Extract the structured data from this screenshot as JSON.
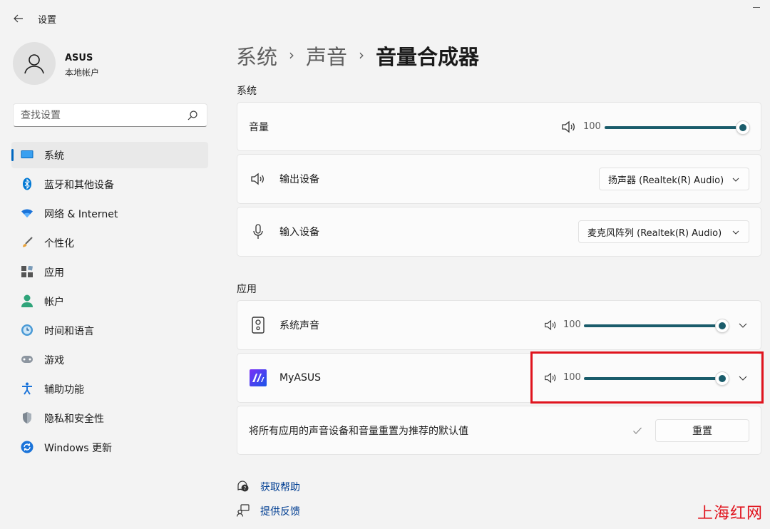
{
  "window": {
    "title": "设置"
  },
  "account": {
    "name": "ASUS",
    "type": "本地帐户"
  },
  "search": {
    "placeholder": "查找设置"
  },
  "sidebar": {
    "items": [
      {
        "label": "系统",
        "icon": "system-icon",
        "active": true
      },
      {
        "label": "蓝牙和其他设备",
        "icon": "bluetooth-icon"
      },
      {
        "label": "网络 & Internet",
        "icon": "wifi-icon"
      },
      {
        "label": "个性化",
        "icon": "brush-icon"
      },
      {
        "label": "应用",
        "icon": "apps-icon"
      },
      {
        "label": "帐户",
        "icon": "person-icon"
      },
      {
        "label": "时间和语言",
        "icon": "clock-icon"
      },
      {
        "label": "游戏",
        "icon": "gamepad-icon"
      },
      {
        "label": "辅助功能",
        "icon": "accessibility-icon"
      },
      {
        "label": "隐私和安全性",
        "icon": "shield-icon"
      },
      {
        "label": "Windows 更新",
        "icon": "update-icon"
      }
    ]
  },
  "breadcrumb": {
    "items": [
      "系统",
      "声音",
      "音量合成器"
    ],
    "separator": "›"
  },
  "system_section": {
    "title": "系统",
    "volume": {
      "label": "音量",
      "value": "100",
      "level": 1.0
    },
    "output": {
      "label": "输出设备",
      "selected": "扬声器 (Realtek(R) Audio)"
    },
    "input": {
      "label": "输入设备",
      "selected": "麦克风阵列 (Realtek(R) Audio)"
    }
  },
  "apps_section": {
    "title": "应用",
    "apps": [
      {
        "name": "系统声音",
        "value": "100",
        "level": 1.0,
        "icon": "speaker-box-icon"
      },
      {
        "name": "MyASUS",
        "value": "100",
        "level": 1.0,
        "icon": "myasus-logo-icon"
      }
    ],
    "reset": {
      "label": "将所有应用的声音设备和音量重置为推荐的默认值",
      "button": "重置"
    }
  },
  "links": {
    "help": "获取帮助",
    "feedback": "提供反馈"
  },
  "watermark": "上海红网",
  "colors": {
    "accent": "#0067c0",
    "slider": "#1a5c6b",
    "highlight": "#e0141e",
    "link": "#003e92"
  }
}
